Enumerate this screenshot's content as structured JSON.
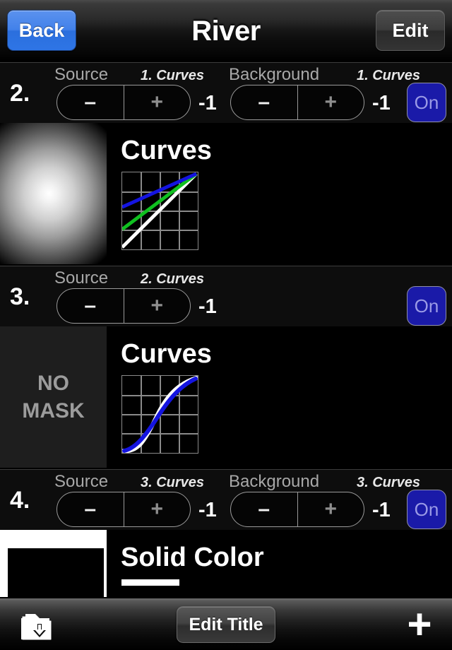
{
  "navbar": {
    "back_label": "Back",
    "title": "River",
    "edit_label": "Edit"
  },
  "rows": [
    {
      "number": "2.",
      "source_label": "Source",
      "source_value": "1. Curves",
      "source_minus": "–",
      "source_plus": "+",
      "source_amount": "-1",
      "background_label": "Background",
      "background_value": "1. Curves",
      "background_minus": "–",
      "background_plus": "+",
      "background_amount": "-1",
      "toggle_label": "On"
    },
    {
      "number": "3.",
      "source_label": "Source",
      "source_value": "2. Curves",
      "source_minus": "–",
      "source_plus": "+",
      "source_amount": "-1",
      "toggle_label": "On"
    },
    {
      "number": "4.",
      "source_label": "Source",
      "source_value": "3. Curves",
      "source_minus": "–",
      "source_plus": "+",
      "source_amount": "-1",
      "background_label": "Background",
      "background_value": "3. Curves",
      "background_minus": "–",
      "background_plus": "+",
      "background_amount": "-1",
      "toggle_label": "On"
    }
  ],
  "panels": [
    {
      "title": "Curves",
      "mask_text": ""
    },
    {
      "title": "Curves",
      "mask_text": "NO\nMASK",
      "mask_line1": "NO",
      "mask_line2": "MASK"
    },
    {
      "title": "Solid Color"
    }
  ],
  "toolbar": {
    "save_icon": "folder-download-icon",
    "edit_title_label": "Edit Title",
    "add_label": "+"
  },
  "colors": {
    "accent_blue": "#2e75e6",
    "toggle_on_bg": "#1a1aa8",
    "toggle_on_text": "#9a9ae6",
    "curve_blue": "#1414e0",
    "curve_green": "#10c020",
    "curve_white": "#ffffff",
    "panel_bg": "#000000",
    "row_bg": "#0d0d0d"
  }
}
